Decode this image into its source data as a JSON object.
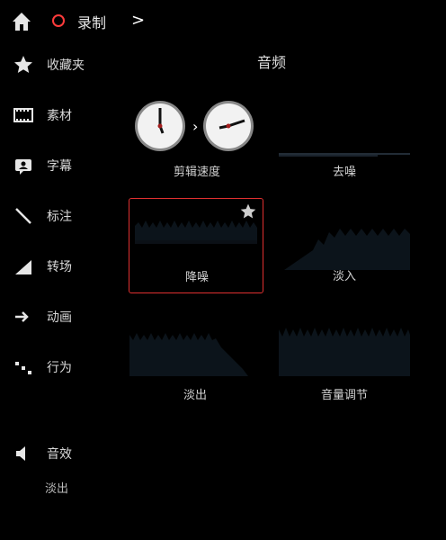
{
  "topbar": {
    "record_label": "录制",
    "chevron": ">",
    "record_color": "#e03030"
  },
  "sidebar": {
    "items": [
      {
        "label": "收藏夹",
        "icon": "star-icon"
      },
      {
        "label": "素材",
        "icon": "film-icon"
      },
      {
        "label": "字幕",
        "icon": "caption-icon"
      },
      {
        "label": "标注",
        "icon": "line-icon"
      },
      {
        "label": "转场",
        "icon": "ramp-icon"
      },
      {
        "label": "动画",
        "icon": "arrow-icon"
      },
      {
        "label": "行为",
        "icon": "dots-icon"
      },
      {
        "label": "音效",
        "icon": "speaker-icon"
      }
    ],
    "sub_label": "淡出"
  },
  "main": {
    "title": "音频",
    "tiles": [
      {
        "name": "剪辑速度"
      },
      {
        "name": "去噪"
      },
      {
        "name": "降噪"
      },
      {
        "name": "淡入"
      },
      {
        "name": "淡出"
      },
      {
        "name": "音量调节"
      }
    ]
  }
}
